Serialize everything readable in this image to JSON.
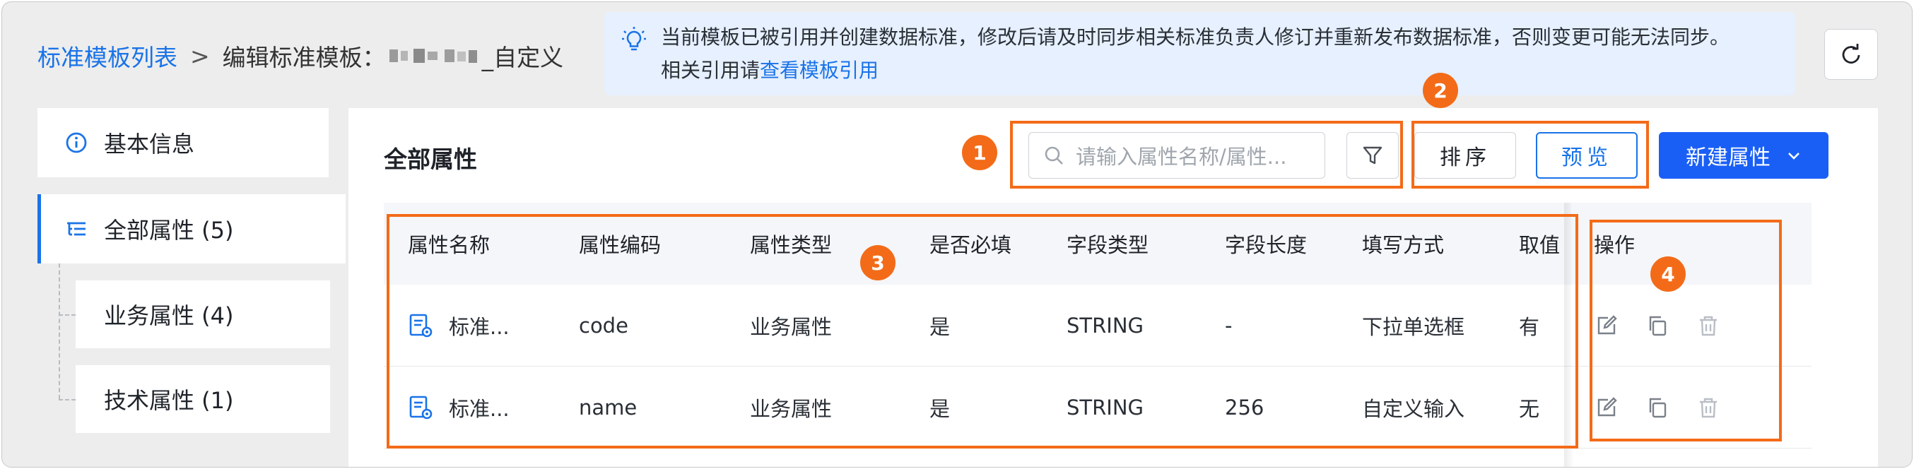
{
  "header": {
    "breadcrumb_root": "标准模板列表",
    "breadcrumb_sep": ">",
    "breadcrumb_current_prefix": "编辑标准模板：",
    "breadcrumb_current_suffix": "_自定义"
  },
  "notice": {
    "line1": "当前模板已被引用并创建数据标准，修改后请及时同步相关标准负责人修订并重新发布数据标准，否则变更可能无法同步。",
    "line2_prefix": "相关引用请",
    "line2_link": "查看模板引用"
  },
  "sidebar": {
    "basic_info": "基本信息",
    "all_attributes": "全部属性 (5)",
    "business_attributes": "业务属性 (4)",
    "technical_attributes": "技术属性 (1)"
  },
  "main": {
    "title": "全部属性",
    "search_placeholder": "请输入属性名称/属性...",
    "sort_label": "排序",
    "preview_label": "预览",
    "new_attribute_label": "新建属性"
  },
  "table": {
    "columns": [
      "属性名称",
      "属性编码",
      "属性类型",
      "是否必填",
      "字段类型",
      "字段长度",
      "填写方式",
      "取值",
      "操作"
    ],
    "rows": [
      [
        "标准...",
        "code",
        "业务属性",
        "是",
        "STRING",
        "-",
        "下拉单选框",
        "有"
      ],
      [
        "标准...",
        "name",
        "业务属性",
        "是",
        "STRING",
        "256",
        "自定义输入",
        "无"
      ]
    ]
  },
  "annotations": [
    "1",
    "2",
    "3",
    "4"
  ],
  "colors": {
    "accent": "#1a73e8",
    "primary_button": "#1a5ff5",
    "annotation": "#f36b18"
  },
  "icons": [
    "bulb-icon",
    "refresh-icon",
    "info-icon",
    "tree-icon",
    "search-icon",
    "filter-icon",
    "chevron-down-icon",
    "attribute-icon",
    "edit-icon",
    "copy-icon",
    "delete-icon"
  ]
}
